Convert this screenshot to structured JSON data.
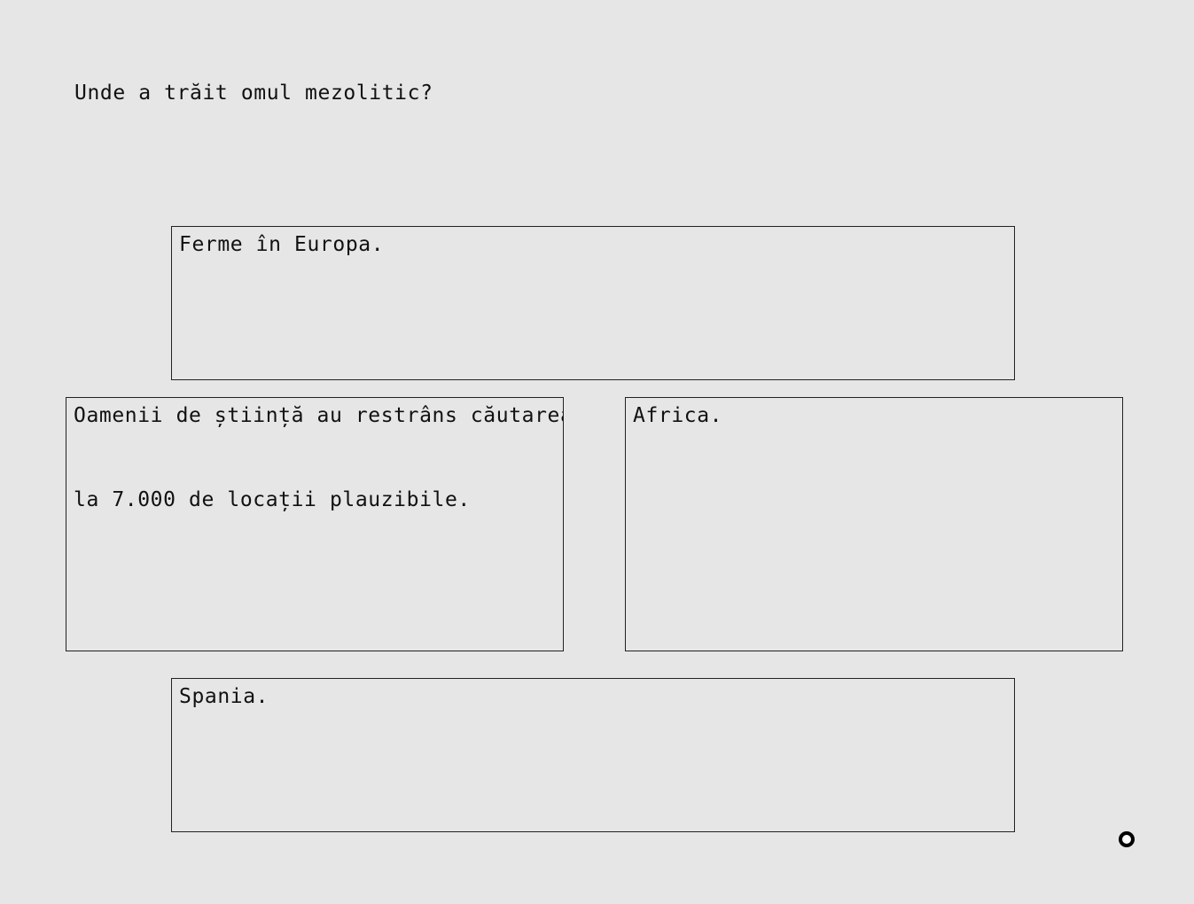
{
  "question": "Unde a trăit omul mezolitic?",
  "answers": [
    {
      "lines": [
        "Ferme în Europa."
      ]
    },
    {
      "lines": [
        "Oamenii de știință au restrâns căutarea",
        "la 7.000 de locații plauzibile."
      ]
    },
    {
      "lines": [
        "Africa."
      ]
    },
    {
      "lines": [
        "Spania."
      ]
    }
  ],
  "cursor": {
    "icon": "ring-cursor-icon"
  }
}
